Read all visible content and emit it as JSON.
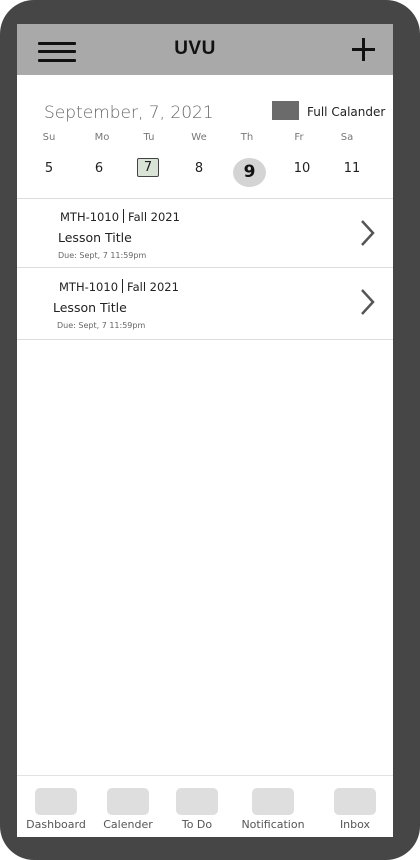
{
  "header": {
    "title": "UVU",
    "menu_icon": "hamburger-menu-icon",
    "add_icon": "plus-icon"
  },
  "calendar": {
    "date_heading": "September, 7, 2021",
    "full_calendar_label": "Full Calander",
    "weekdays": [
      "Su",
      "Mo",
      "Tu",
      "We",
      "Th",
      "Fr",
      "Sa"
    ],
    "days": [
      "5",
      "6",
      "7",
      "8",
      "9",
      "10",
      "11"
    ],
    "selected_day": "7",
    "today": "9"
  },
  "lessons": [
    {
      "course": "MTH-1010",
      "term": "Fall 2021",
      "title": "Lesson Title",
      "due": "Due: Sept, 7 11:59pm"
    },
    {
      "course": "MTH-1010",
      "term": "Fall 2021",
      "title": "Lesson Title",
      "due": "Due: Sept, 7 11:59pm"
    }
  ],
  "bottom_nav": {
    "items": [
      {
        "label": "Dashboard"
      },
      {
        "label": "Calender"
      },
      {
        "label": "To Do"
      },
      {
        "label": "Notification"
      },
      {
        "label": "Inbox"
      }
    ]
  },
  "colors": {
    "device_frame": "#464646",
    "header_bar": "#a9a9a9",
    "selected_day_fill": "#d9e4d6",
    "today_circle": "#d4d4d4"
  }
}
